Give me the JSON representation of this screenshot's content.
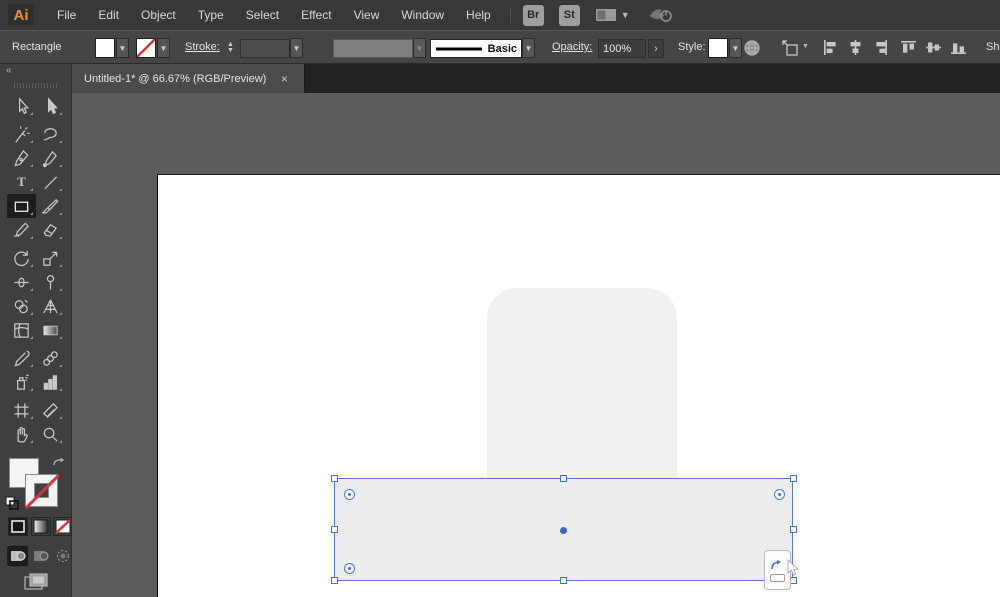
{
  "menubar": {
    "logo": "Ai",
    "items": [
      "File",
      "Edit",
      "Object",
      "Type",
      "Select",
      "Effect",
      "View",
      "Window",
      "Help"
    ],
    "bridge_label": "Br",
    "stock_label": "St"
  },
  "controlbar": {
    "tool_label": "Rectangle",
    "stroke_label": "Stroke:",
    "brush_style": "Basic",
    "opacity_label": "Opacity:",
    "opacity_value": "100%",
    "opacity_more_glyph": "›",
    "style_label": "Style:",
    "shape_label_partial": "Sh"
  },
  "tabbar": {
    "collapse_glyph": "«",
    "title": "Untitled-1* @ 66.67% (RGB/Preview)",
    "close_glyph": "×"
  },
  "tools": [
    "selection",
    "direct-selection",
    "magic-wand",
    "lasso",
    "pen",
    "curvature",
    "type",
    "line-segment",
    "rectangle",
    "paintbrush",
    "shaper",
    "eraser",
    "rotate",
    "scale",
    "width",
    "puppet-warp",
    "shape-builder",
    "perspective-grid",
    "mesh",
    "gradient",
    "eyedropper",
    "blend",
    "symbol-sprayer",
    "column-graph",
    "artboard",
    "slice",
    "hand",
    "zoom"
  ],
  "selected_tool": "rectangle",
  "tool_groups_after": [
    "direct-selection",
    "eraser",
    "gradient",
    "column-graph"
  ],
  "colors": {
    "accent_blue": "#4a6ed0",
    "selection_blue": "#5577d4",
    "canvas_bg": "#5d5d5d",
    "artboard_white": "#ffffff",
    "shape_fill": "#ededee",
    "rounded_shape_fill": "#f0f0f1",
    "menubar_bg": "#383838",
    "controlbar_bg": "#454545",
    "tabbar_bg": "#232323",
    "tab_active_bg": "#4b4b4b",
    "dock_bg": "#3f3f3f",
    "stroke_none_red": "#d6343c",
    "logo_orange": "#e8923a"
  }
}
